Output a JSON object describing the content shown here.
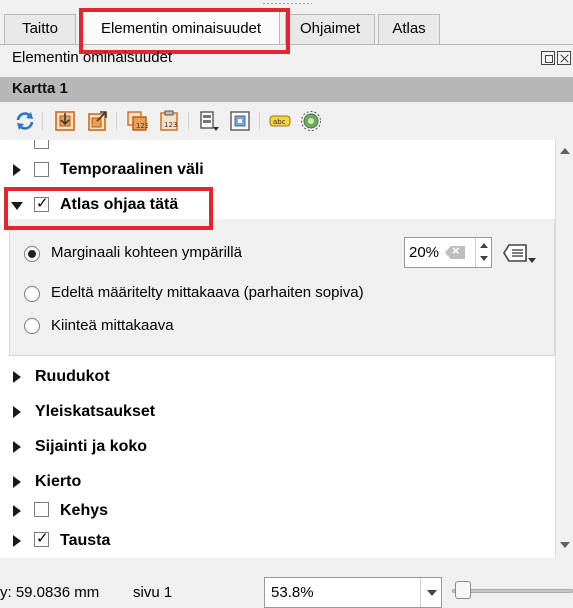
{
  "tabs": [
    {
      "label": "Taitto",
      "active": false
    },
    {
      "label": "Elementin ominaisuudet",
      "active": true
    },
    {
      "label": "Ohjaimet",
      "active": false
    },
    {
      "label": "Atlas",
      "active": false
    }
  ],
  "dock": {
    "title": "Elementin ominaisuudet",
    "float_icon": "float-window-icon",
    "close_icon": "close-icon"
  },
  "item": {
    "title": "Kartta 1"
  },
  "toolbar": {
    "icons": [
      "refresh-icon",
      "set-extent-to-map-canvas-icon",
      "view-extent-in-canvas-icon",
      "copy-extent-icon",
      "paste-extent-icon",
      "map-themes-icon",
      "lock-layers-icon",
      "label-settings-icon",
      "bookmark-icon"
    ]
  },
  "groups": {
    "temporal": {
      "label": "Temporaalinen väli",
      "checked": false,
      "expanded": false
    },
    "atlas": {
      "label": "Atlas ohjaa tätä",
      "checked": true,
      "expanded": true,
      "options": [
        {
          "label": "Marginaali kohteen ympärillä",
          "selected": true
        },
        {
          "label": "Edeltä määritelty mittakaava (parhaiten sopiva)",
          "selected": false
        },
        {
          "label": "Kiinteä mittakaava",
          "selected": false
        }
      ],
      "margin_value": "20%"
    },
    "grids": {
      "label": "Ruudukot",
      "expanded": false
    },
    "overviews": {
      "label": "Yleiskatsaukset",
      "expanded": false
    },
    "position_size": {
      "label": "Sijainti ja koko",
      "expanded": false
    },
    "rotation": {
      "label": "Kierto",
      "expanded": false
    },
    "frame": {
      "label": "Kehys",
      "checked": false,
      "expanded": false
    },
    "background": {
      "label": "Tausta",
      "checked": true,
      "expanded": false
    }
  },
  "status": {
    "y_coord": "y: 59.0836 mm",
    "page": "sivu 1",
    "zoom": "53.8%",
    "zoom_slider_level": 0.05
  },
  "colors": {
    "highlight": "#e32530",
    "item_bar": "#b7b7b7",
    "toolbar_blue": "#2a78c8",
    "toolbar_orange": "#e07a1c"
  }
}
